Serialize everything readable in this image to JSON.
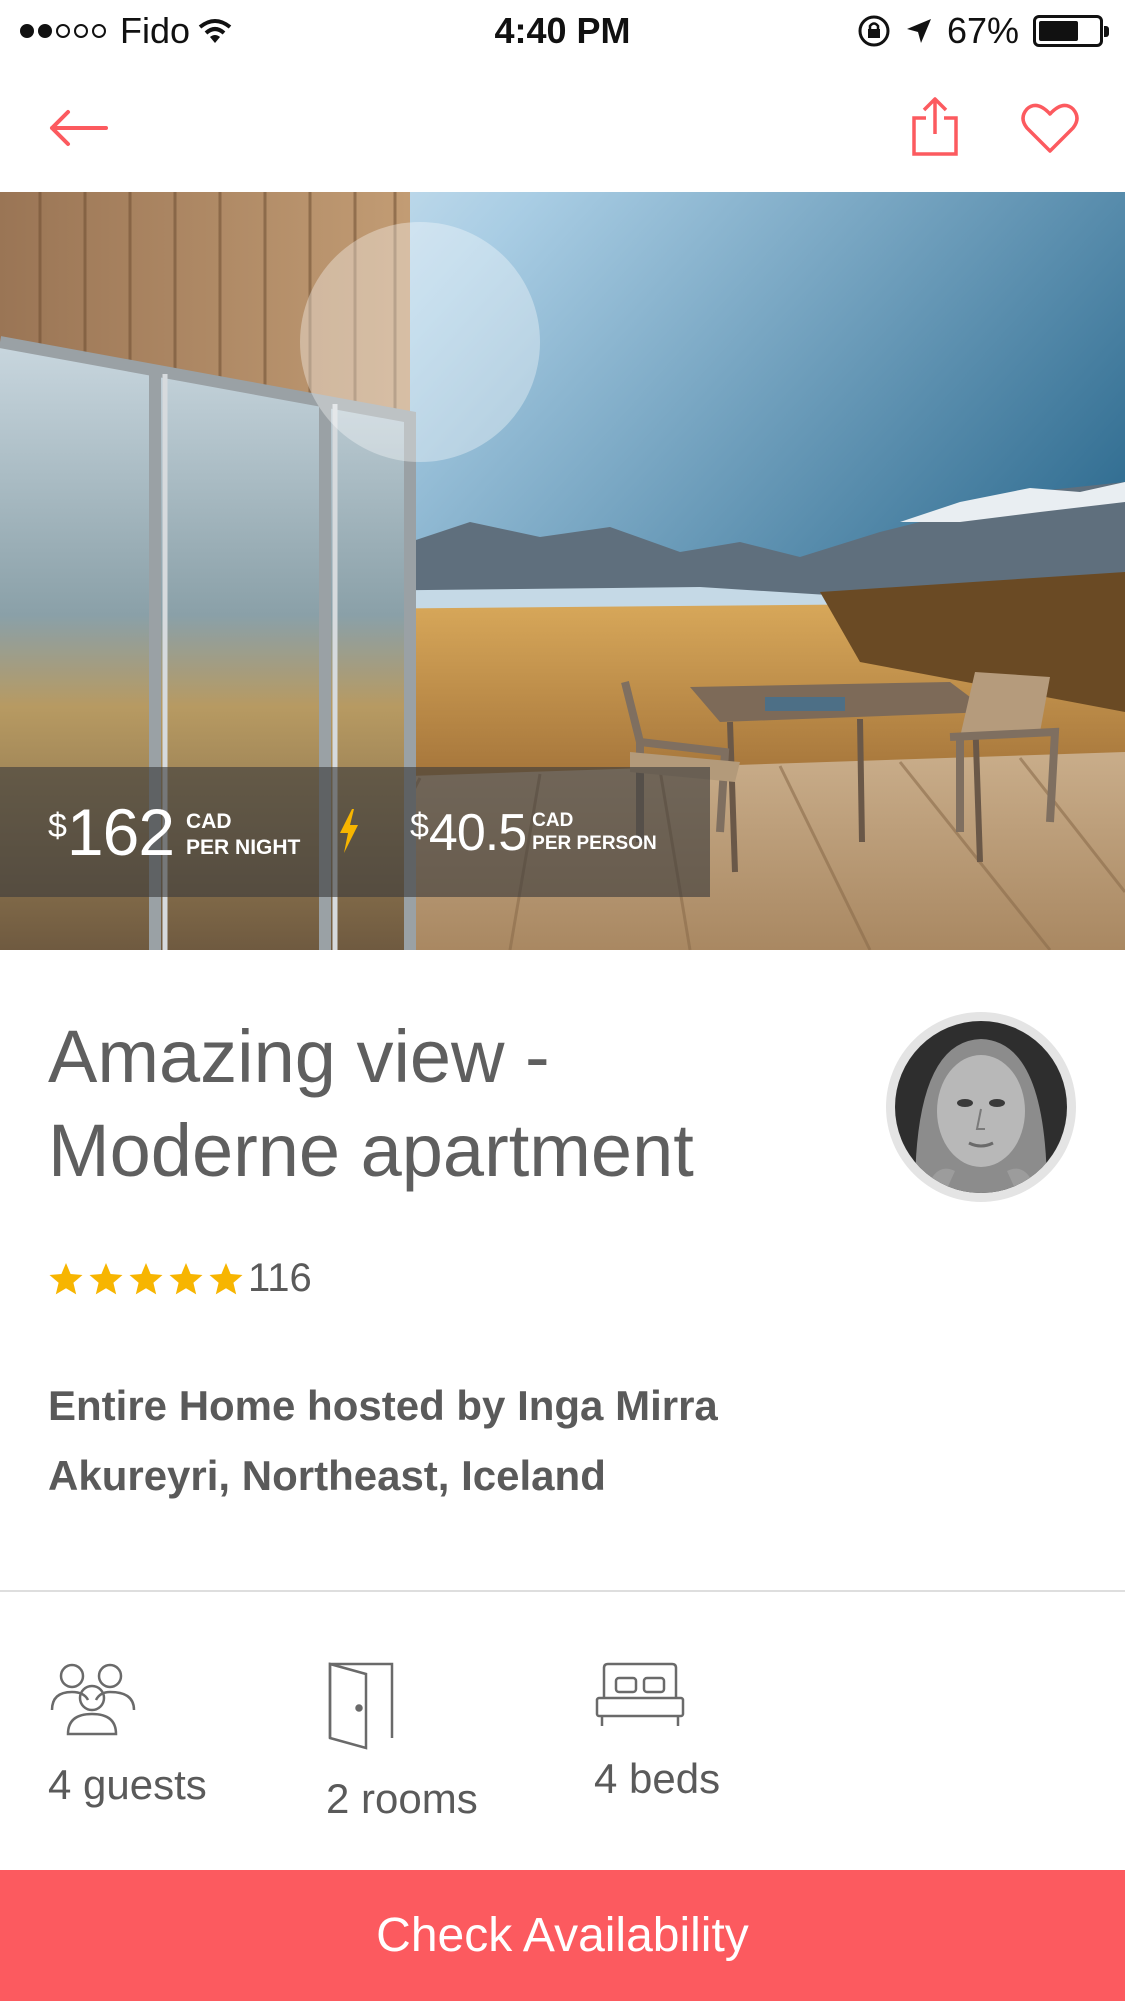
{
  "status_bar": {
    "carrier": "Fido",
    "time": "4:40 PM",
    "battery": "67%",
    "battery_level": 0.67,
    "signal_strength": 2
  },
  "nav": {
    "back_icon": "arrow-left-icon",
    "share_icon": "share-icon",
    "favorite_icon": "heart-icon",
    "accent_color": "#fc5a5f"
  },
  "listing": {
    "price_night": {
      "currency_symbol": "$",
      "amount": "162",
      "currency": "CAD",
      "unit": "PER NIGHT"
    },
    "price_person": {
      "currency_symbol": "$",
      "amount": "40.5",
      "currency": "CAD",
      "unit": "PER PERSON"
    },
    "instant_book_icon": "lightning-icon",
    "title": "Amazing view - Moderne apartment",
    "rating": 5,
    "review_count": "116",
    "host_line": "Entire Home hosted by Inga Mirra",
    "location": "Akureyri, Northeast, Iceland"
  },
  "amenities": [
    {
      "icon": "guests-icon",
      "label": "4 guests"
    },
    {
      "icon": "door-icon",
      "label": "2 rooms"
    },
    {
      "icon": "bed-icon",
      "label": "4 beds"
    }
  ],
  "cta": {
    "label": "Check Availability",
    "color": "#fc5a5f"
  }
}
